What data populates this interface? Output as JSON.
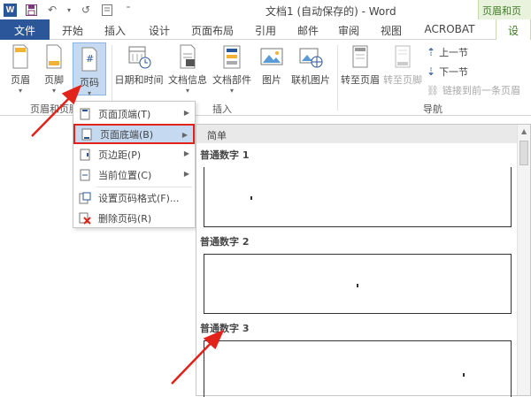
{
  "titlebar": {
    "title": "文档1 (自动保存的) - Word",
    "context_group": "页眉和页"
  },
  "tabs": [
    {
      "label": "文件"
    },
    {
      "label": "开始"
    },
    {
      "label": "插入"
    },
    {
      "label": "设计"
    },
    {
      "label": "页面布局"
    },
    {
      "label": "引用"
    },
    {
      "label": "邮件"
    },
    {
      "label": "审阅"
    },
    {
      "label": "视图"
    },
    {
      "label": "ACROBAT"
    },
    {
      "label": "设"
    }
  ],
  "ribbon": {
    "header_footer": {
      "header": "页眉",
      "footer": "页脚",
      "page_number": "页码",
      "group": "页眉和页脚"
    },
    "insert": {
      "datetime": "日期和时间",
      "docinfo": "文档信息",
      "docparts": "文档部件",
      "picture": "图片",
      "online_picture": "联机图片",
      "group": "插入"
    },
    "navigation": {
      "goto_header": "转至页眉",
      "goto_footer": "转至页脚",
      "prev": "上一节",
      "next": "下一节",
      "link_prev": "链接到前一条页眉",
      "group": "导航"
    }
  },
  "page_number_menu": [
    {
      "label": "页面顶端(T)",
      "has_submenu": true
    },
    {
      "label": "页面底端(B)",
      "has_submenu": true,
      "highlighted": true
    },
    {
      "label": "页边距(P)",
      "has_submenu": true
    },
    {
      "label": "当前位置(C)",
      "has_submenu": true
    },
    {
      "label": "设置页码格式(F)...",
      "has_submenu": false
    },
    {
      "label": "删除页码(R)",
      "has_submenu": false
    }
  ],
  "gallery": {
    "section": "简单",
    "items": [
      {
        "label": "普通数字 1"
      },
      {
        "label": "普通数字 2"
      },
      {
        "label": "普通数字 3"
      }
    ]
  },
  "colors": {
    "file_tab": "#2b579a",
    "context_tab": "#3f7a26",
    "highlight": "#c5d9f1",
    "annotation": "#e2231a"
  }
}
